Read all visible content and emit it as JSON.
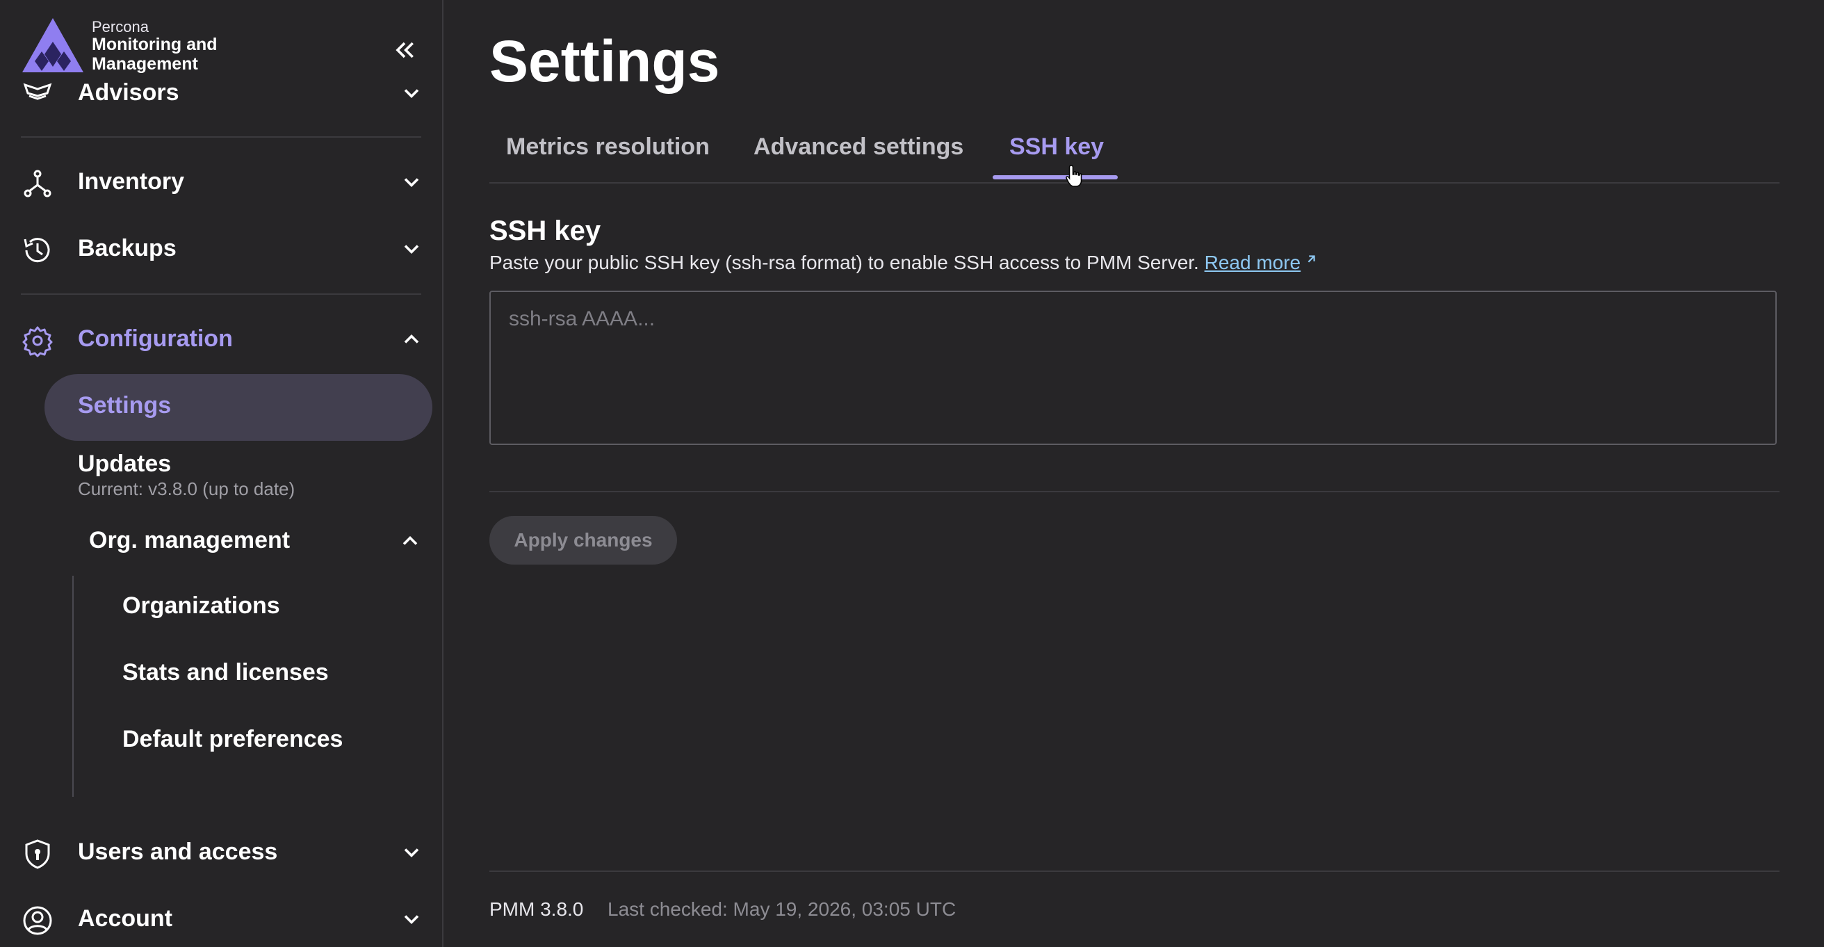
{
  "brand": {
    "company": "Percona",
    "product": "Monitoring and Management"
  },
  "sidebar": {
    "items": [
      {
        "label": "Advisors",
        "icon": "advisors-icon"
      },
      {
        "label": "Inventory",
        "icon": "inventory-icon"
      },
      {
        "label": "Backups",
        "icon": "backups-icon"
      },
      {
        "label": "Configuration",
        "icon": "gear-icon"
      },
      {
        "label": "Users and access",
        "icon": "shield-icon"
      },
      {
        "label": "Account",
        "icon": "account-icon"
      }
    ],
    "configuration_children": {
      "settings": "Settings",
      "updates": "Updates",
      "updates_caption": "Current: v3.8.0 (up to date)",
      "org_management": "Org. management",
      "org_children": [
        "Organizations",
        "Stats and licenses",
        "Default preferences"
      ]
    }
  },
  "main": {
    "title": "Settings",
    "tabs": [
      {
        "label": "Metrics resolution",
        "active": false
      },
      {
        "label": "Advanced settings",
        "active": false
      },
      {
        "label": "SSH key",
        "active": true
      }
    ],
    "section": {
      "title": "SSH key",
      "description": "Paste your public SSH key (ssh-rsa format) to enable SSH access to PMM Server.",
      "read_more": "Read more",
      "placeholder": "ssh-rsa AAAA...",
      "value": ""
    },
    "apply_label": "Apply changes"
  },
  "footer": {
    "version": "PMM 3.8.0",
    "last_checked": "Last checked: May 19, 2026, 03:05 UTC"
  },
  "colors": {
    "accent": "#a79bf0",
    "background": "#262527",
    "link": "#8ec8f2"
  }
}
